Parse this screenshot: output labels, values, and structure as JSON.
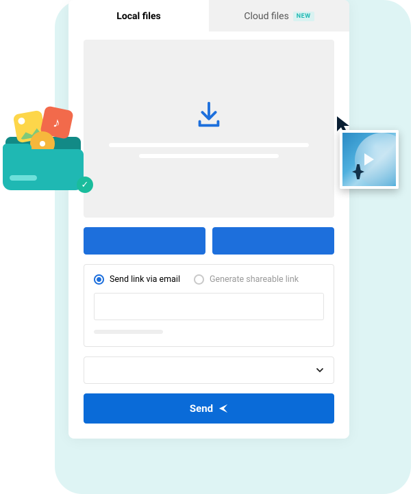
{
  "tabs": {
    "local": {
      "label": "Local files"
    },
    "cloud": {
      "label": "Cloud files",
      "badge": "NEW"
    }
  },
  "options": {
    "email": {
      "label": "Send link via email",
      "selected": true
    },
    "link": {
      "label": "Generate shareable link",
      "selected": false
    }
  },
  "send_button": {
    "label": "Send"
  },
  "icons": {
    "download": "download-icon",
    "chevron": "chevron-down-icon",
    "send_arrow": "paper-plane-icon",
    "cursor": "cursor-icon",
    "check": "check-icon",
    "music": "music-icon",
    "play": "play-icon"
  },
  "colors": {
    "primary_blue": "#1d6fdc",
    "accent_teal": "#1fb8b3",
    "send_blue": "#0a6bd8"
  }
}
